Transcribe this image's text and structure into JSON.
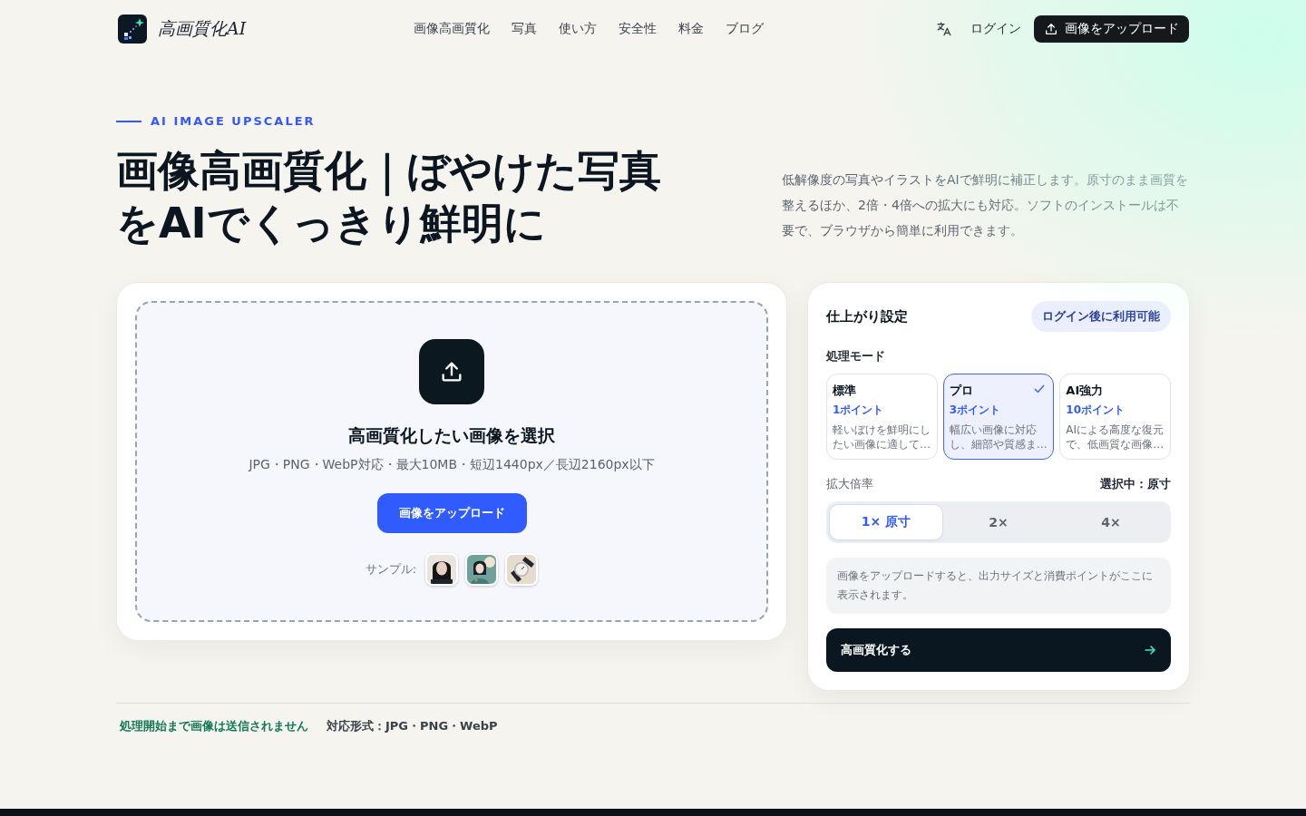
{
  "header": {
    "logo_text": "高画質化AI",
    "nav": [
      {
        "label": "画像高画質化"
      },
      {
        "label": "写真"
      },
      {
        "label": "使い方"
      },
      {
        "label": "安全性"
      },
      {
        "label": "料金"
      },
      {
        "label": "ブログ"
      }
    ],
    "login": "ログイン",
    "upload_button": "画像をアップロード"
  },
  "hero": {
    "eyebrow": "AI IMAGE UPSCALER",
    "title_lines": [
      "画像高画質化｜ぼやけた写真",
      "をAIでくっきり鮮明に"
    ],
    "description": "低解像度の写真やイラストをAIで鮮明に補正します。原寸のまま画質を整えるほか、2倍・4倍への拡大にも対応。ソフトのインストールは不要で、ブラウザから簡単に利用できます。"
  },
  "upload": {
    "title": "高画質化したい画像を選択",
    "formats": "JPG・PNG・WebP対応・最大10MB・短辺1440px／長辺2160px以下",
    "button": "画像をアップロード",
    "samples_label": "サンプル:",
    "samples": [
      {
        "kind": "portrait"
      },
      {
        "kind": "illustration"
      },
      {
        "kind": "watch"
      }
    ]
  },
  "settings": {
    "title": "仕上がり設定",
    "badge": "ログイン後に利用可能",
    "mode_label": "処理モード",
    "modes": [
      {
        "name": "標準",
        "points": "1ポイント",
        "description": "軽いぼけを鮮明にしたい画像に適して…",
        "selected": false
      },
      {
        "name": "プロ",
        "points": "3ポイント",
        "description": "幅広い画像に対応し、細部や質感ま…",
        "selected": true
      },
      {
        "name": "AI強力",
        "points": "10ポイント",
        "description": "AIによる高度な復元で、低画質な画像…",
        "selected": false
      }
    ],
    "scale_label": "拡大倍率",
    "scale_current": "選択中：原寸",
    "scales": [
      {
        "label": "1× 原寸",
        "selected": true
      },
      {
        "label": "2×",
        "selected": false
      },
      {
        "label": "4×",
        "selected": false
      }
    ],
    "info": "画像をアップロードすると、出力サイズと消費ポイントがここに表示されます。",
    "submit": "高画質化する"
  },
  "trust": [
    {
      "text": "処理開始まで画像は送信されません",
      "kind": "highlight"
    },
    {
      "text": "対応形式：JPG・PNG・WebP",
      "kind": "plain"
    }
  ]
}
